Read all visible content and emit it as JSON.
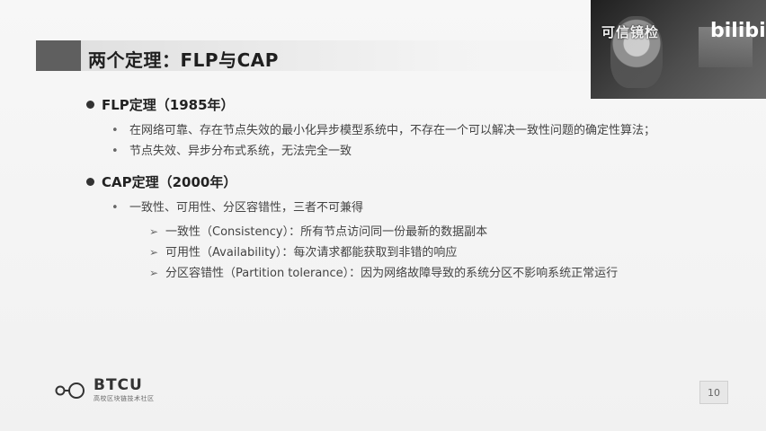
{
  "title": "两个定理：FLP与CAP",
  "sections": [
    {
      "title": "FLP定理（1985年）",
      "items": [
        {
          "text": "在网络可靠、存在节点失效的最小化异步模型系统中，不存在一个可以解决一致性问题的确定性算法；"
        },
        {
          "text": "节点失效、异步分布式系统，无法完全一致"
        }
      ]
    },
    {
      "title": "CAP定理（2000年）",
      "items": [
        {
          "text": "一致性、可用性、分区容错性，三者不可兼得"
        }
      ],
      "sub_items": [
        {
          "text": "一致性（Consistency）：所有节点访问同一份最新的数据副本"
        },
        {
          "text": "可用性（Availability）：每次请求都能获取到非错的响应"
        },
        {
          "text": "分区容错性（Partition tolerance）：因为网络故障导致的系统分区不影响系统正常运行"
        }
      ]
    }
  ],
  "logo": {
    "name": "BTCU",
    "sub": "高校区块链技术社区"
  },
  "page": "10",
  "overlay": {
    "left_text": "可信镜检",
    "right_text": "bilibili"
  },
  "icons": [
    "bullet-dot-icon",
    "small-dot-icon",
    "arrow-icon",
    "logo-icon"
  ],
  "colors": {
    "accent": "#5f5f5f",
    "background": "#f4f4f4",
    "text": "#333333"
  }
}
